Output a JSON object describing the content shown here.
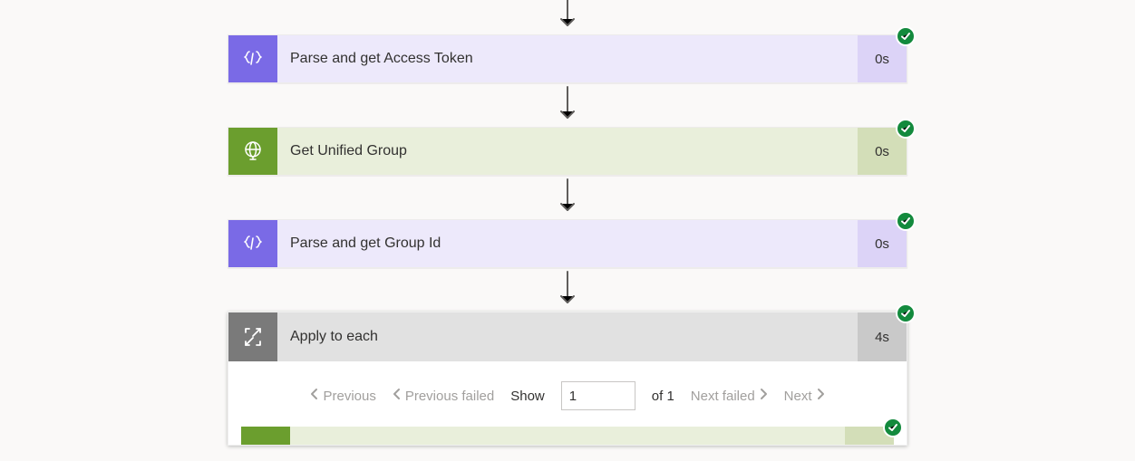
{
  "steps": {
    "s1": {
      "title": "Parse and get Access Token",
      "duration": "0s",
      "status": "success",
      "icon": "code-icon",
      "theme": "purple"
    },
    "s2": {
      "title": "Get Unified Group",
      "duration": "0s",
      "status": "success",
      "icon": "globe-icon",
      "theme": "green"
    },
    "s3": {
      "title": "Parse and get Group Id",
      "duration": "0s",
      "status": "success",
      "icon": "code-icon",
      "theme": "purple"
    },
    "s4": {
      "title": "Apply to each",
      "duration": "4s",
      "status": "success",
      "icon": "loop-icon",
      "theme": "gray"
    }
  },
  "pager": {
    "previous": "Previous",
    "previous_failed": "Previous failed",
    "show_label": "Show",
    "page_value": "1",
    "of_text": "of 1",
    "next_failed": "Next failed",
    "next": "Next"
  },
  "inner": {
    "status": "success"
  }
}
